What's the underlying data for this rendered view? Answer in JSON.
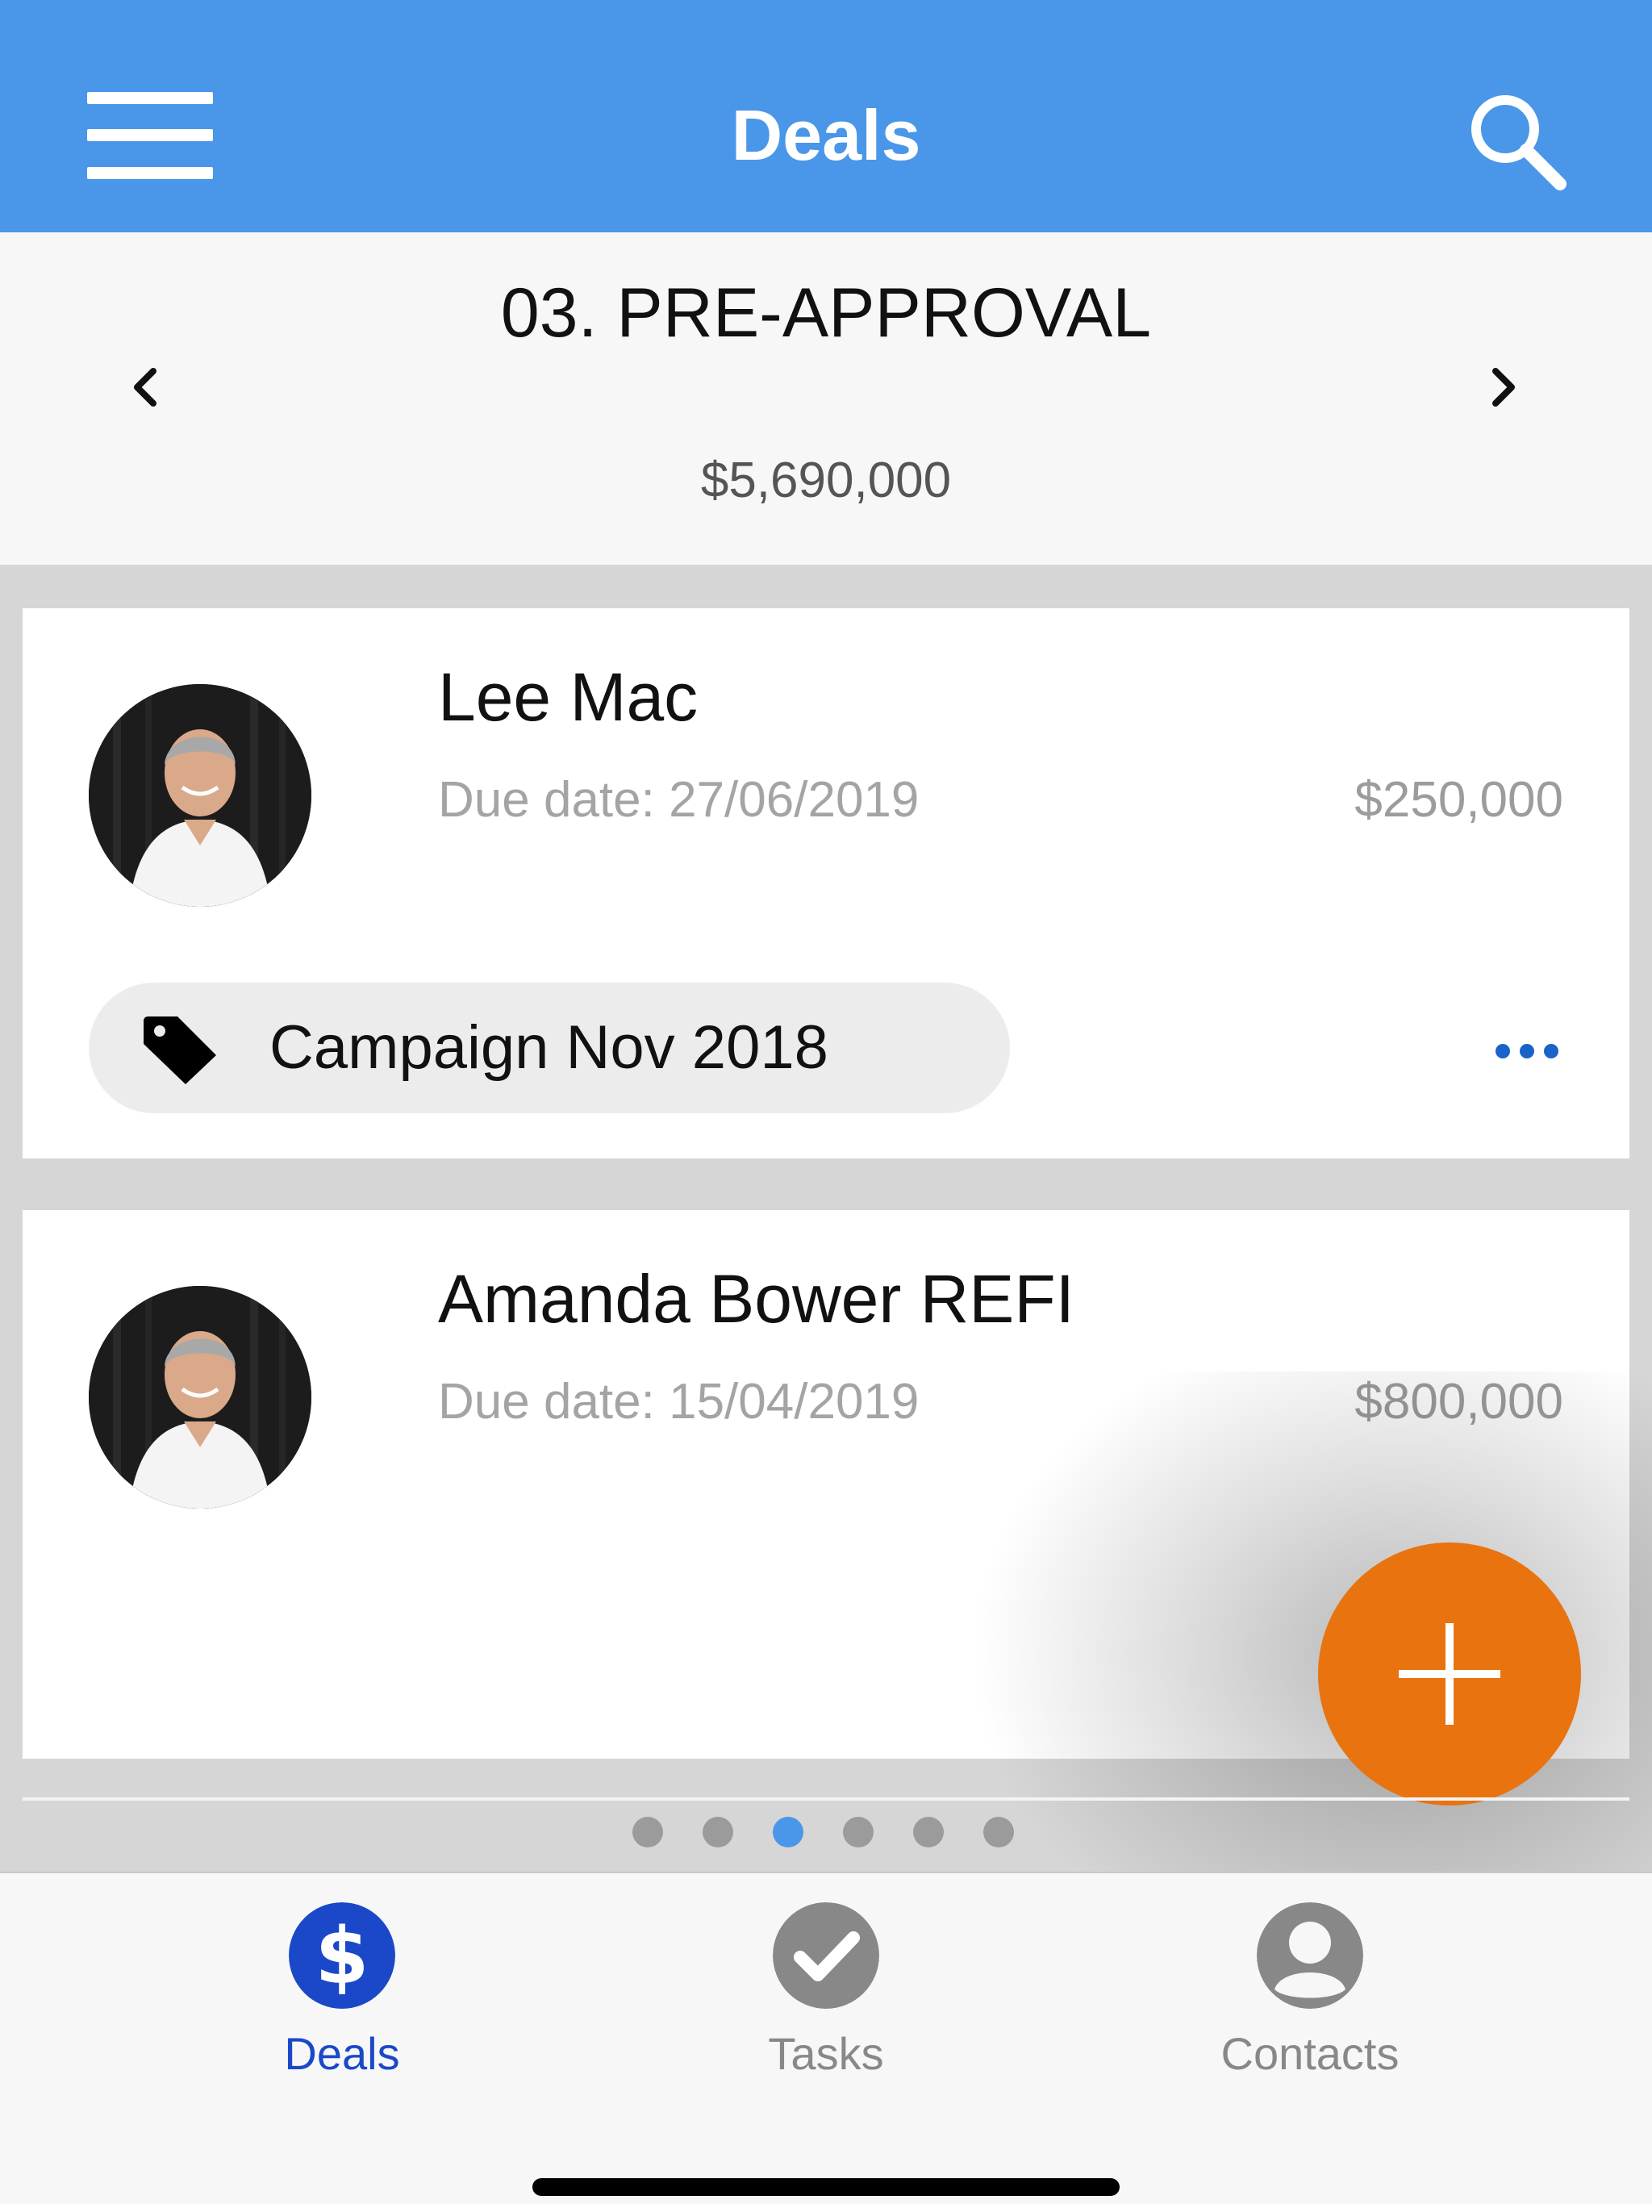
{
  "header": {
    "title": "Deals",
    "menu_icon": "hamburger-menu-icon",
    "search_icon": "search-icon"
  },
  "stage": {
    "title": "03. PRE-APPROVAL",
    "total": "$5,690,000"
  },
  "deals": [
    {
      "name": "Lee Mac",
      "due": "Due date: 27/06/2019",
      "amount": "$250,000",
      "tag": "Campaign Nov 2018"
    },
    {
      "name": "Amanda Bower REFI",
      "due": "Due date: 15/04/2019",
      "amount": "$800,000"
    }
  ],
  "pager": {
    "count": 6,
    "active_index": 2
  },
  "tabs": [
    {
      "label": "Deals",
      "icon": "dollar-icon",
      "active": true
    },
    {
      "label": "Tasks",
      "icon": "check-icon",
      "active": false
    },
    {
      "label": "Contacts",
      "icon": "person-icon",
      "active": false
    }
  ],
  "colors": {
    "header": "#4a96e8",
    "fab": "#e8730f",
    "tab_active": "#1a48c8",
    "tab_inactive": "#888888"
  }
}
